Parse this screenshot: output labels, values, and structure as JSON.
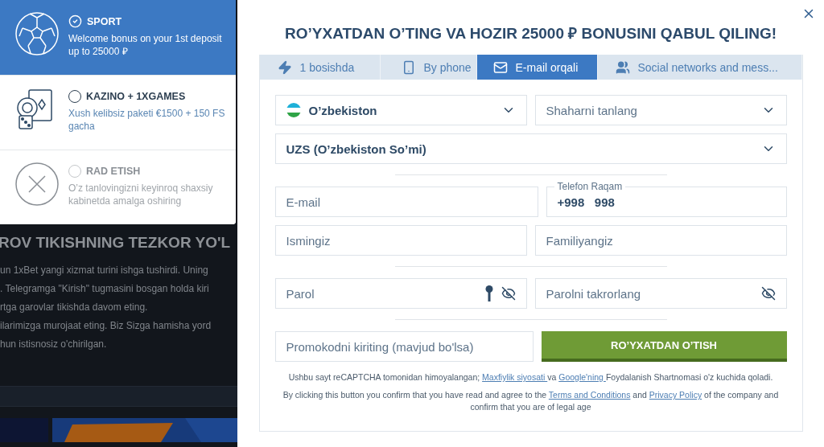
{
  "bonus_options": [
    {
      "kind": "sport",
      "title": "SPORT",
      "description": "Welcome bonus on your 1st deposit up to 25000 ₽",
      "selected": true
    },
    {
      "kind": "casino",
      "title": "KAZINO + 1XGAMES",
      "description": "Xush kelibsiz paketi €1500 + 150 FS gacha",
      "selected": false
    },
    {
      "kind": "decline",
      "title": "RAD ETISH",
      "description": "O’z tanlovingizni keyinroq shaxsiy kabinetda amalga oshiring",
      "selected": false
    }
  ],
  "background_page": {
    "heading": "ROV TIKISHNING TEZKOR YO'L",
    "lines": [
      "un 1xBet yangi xizmat turini ishga tushirdi. Uning",
      ". Telegramga \"Kirish\" tugmasini bosgan holda kiri",
      "rtga garovlar tikishda davom eting.",
      "ilarimizga murojaat eting. Biz Sizga hamisha yord",
      "hun istisnosiz o'chirilgan."
    ]
  },
  "modal": {
    "title": "RO’YXATDAN O’TING VA HOZIR 25000 ₽ BONUSINI QABUL QILING!",
    "tabs": [
      {
        "kind": "bolt",
        "label": "1 bosishda",
        "selected": false
      },
      {
        "kind": "phone",
        "label": "By phone",
        "selected": false
      },
      {
        "kind": "mail",
        "label": "E-mail orqali",
        "selected": true
      },
      {
        "kind": "people",
        "label": "Social networks and mess...",
        "selected": false
      }
    ],
    "groups": [
      {
        "rows": [
          [
            {
              "kind": "country",
              "value": "O’zbekiston"
            },
            {
              "kind": "select",
              "placeholder": "Shaharni tanlang"
            }
          ],
          [
            {
              "kind": "select",
              "value": "UZS (O’zbekiston So’mi)"
            }
          ]
        ]
      },
      {
        "rows": [
          [
            {
              "kind": "input",
              "placeholder": "E-mail"
            },
            {
              "kind": "phone",
              "label": "Telefon Raqam",
              "value": "+998   998"
            }
          ],
          [
            {
              "kind": "input",
              "placeholder": "Ismingiz"
            },
            {
              "kind": "input",
              "placeholder": "Familiyangiz"
            }
          ]
        ]
      },
      {
        "rows": [
          [
            {
              "kind": "password-key",
              "placeholder": "Parol"
            },
            {
              "kind": "password",
              "placeholder": "Parolni takrorlang"
            }
          ]
        ]
      },
      {
        "rows": [
          [
            {
              "kind": "input",
              "placeholder": "Promokodni kiriting (mavjud bo'lsa)"
            },
            {
              "kind": "submit",
              "label": "RO’YXATDAN O’TISH"
            }
          ]
        ]
      }
    ],
    "recaptcha_notice": [
      {
        "text": "Ushbu sayt reCAPTCHA tomonidan himoyalangan; "
      },
      {
        "text": "Maxfiylik siyosati ",
        "link": true
      },
      {
        "text": "va "
      },
      {
        "text": "Google'ning ",
        "link": true
      },
      {
        "text": "Foydalanish Shartnomasi o'z kuchida qoladi."
      }
    ],
    "consent_notice": [
      {
        "text": "By clicking this button you confirm that you have read and agree to the "
      },
      {
        "text": "Terms and Conditions",
        "link": true
      },
      {
        "text": " and "
      },
      {
        "text": "Privacy Policy",
        "link": true
      },
      {
        "text": " of the company and confirm that you are of legal age"
      }
    ]
  }
}
